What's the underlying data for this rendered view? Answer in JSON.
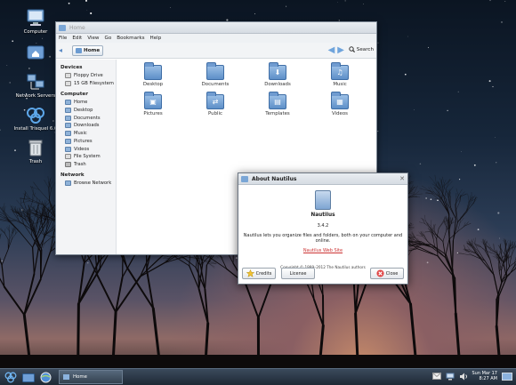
{
  "desktop": {
    "icons": [
      {
        "label": "Computer",
        "icon": "computer-icon"
      },
      {
        "label": "",
        "icon": "home-folder-icon"
      },
      {
        "label": "Network Servers",
        "icon": "network-icon"
      },
      {
        "label": "Install Trisquel 6.0",
        "icon": "trisquel-icon"
      },
      {
        "label": "Trash",
        "icon": "trash-icon"
      }
    ]
  },
  "window": {
    "title": "Home",
    "menu": [
      "File",
      "Edit",
      "View",
      "Go",
      "Bookmarks",
      "Help"
    ],
    "location": "Home",
    "search_label": "Search",
    "sidebar": {
      "devices_header": "Devices",
      "devices": [
        "Floppy Drive",
        "15 GB Filesystem"
      ],
      "computer_header": "Computer",
      "computer": [
        "Home",
        "Desktop",
        "Documents",
        "Downloads",
        "Music",
        "Pictures",
        "Videos",
        "File System",
        "Trash"
      ],
      "network_header": "Network",
      "network": [
        "Browse Network"
      ]
    },
    "folders": [
      {
        "label": "Desktop",
        "glyph": ""
      },
      {
        "label": "Documents",
        "glyph": ""
      },
      {
        "label": "Downloads",
        "glyph": "⬇"
      },
      {
        "label": "Music",
        "glyph": "♫"
      },
      {
        "label": "Pictures",
        "glyph": "▣"
      },
      {
        "label": "Public",
        "glyph": "⇄"
      },
      {
        "label": "Templates",
        "glyph": "▤"
      },
      {
        "label": "Videos",
        "glyph": "▦"
      }
    ]
  },
  "about": {
    "title": "About Nautilus",
    "name": "Nautilus",
    "version": "3.4.2",
    "description": "Nautilus lets you organize files and folders, both on your computer and online.",
    "website": "Nautilus Web Site",
    "copyright": "Copyright © 1999–2012 The Nautilus authors",
    "credits_label": "Credits",
    "license_label": "License",
    "close_label": "Close"
  },
  "taskbar": {
    "task_label": "Home",
    "clock_date": "Sun Mar 17",
    "clock_time": "8:27 AM"
  },
  "colors": {
    "accent": "#5d8fc8",
    "link": "#cc3333",
    "taskbar": "#2a3644"
  }
}
